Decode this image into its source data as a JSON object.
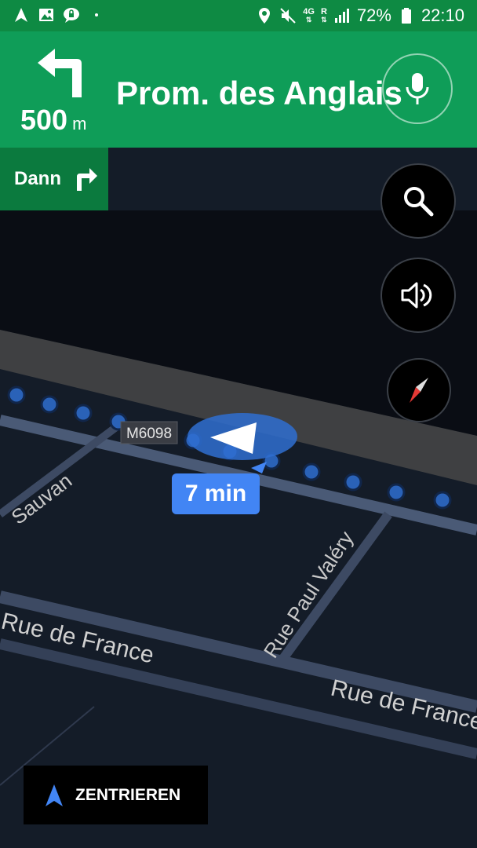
{
  "status_bar": {
    "network": "4G",
    "network_sub": "R",
    "battery": "72%",
    "time": "22:10"
  },
  "nav": {
    "distance_value": "500",
    "distance_unit": "m",
    "street": "Prom. des Anglais",
    "then_label": "Dann"
  },
  "map": {
    "road_labels": [
      {
        "text": "M6098"
      },
      {
        "text": "Sauvan"
      },
      {
        "text": "Rue Paul Valéry"
      },
      {
        "text": "Rue de France"
      },
      {
        "text": "Rue de France"
      }
    ]
  },
  "eta": "7 min",
  "recenter_label": "ZENTRIEREN",
  "colors": {
    "header_green": "#0f9d58",
    "status_green": "#0e8a43",
    "then_green": "#0b7a3e",
    "route_blue": "#4285f4",
    "map_bg": "#141c28"
  }
}
